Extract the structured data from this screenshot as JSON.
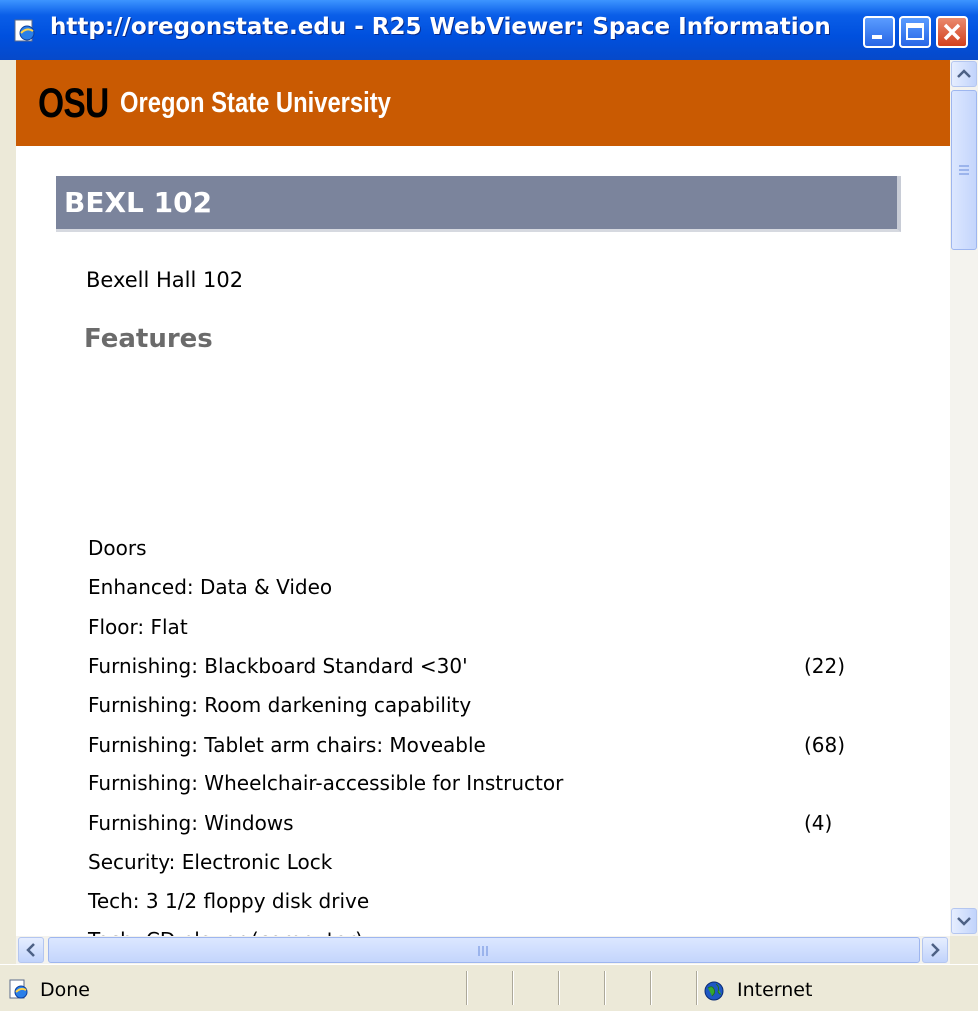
{
  "window": {
    "title": "http://oregonstate.edu - R25 WebViewer: Space Information - Mic..."
  },
  "header": {
    "logo": "OSU",
    "university": "Oregon State University"
  },
  "room": {
    "code": "BEXL 102",
    "name": "Bexell Hall 102"
  },
  "features": {
    "heading": "Features",
    "items": [
      {
        "name": "Doors",
        "qty": ""
      },
      {
        "name": "Enhanced: Data & Video",
        "qty": ""
      },
      {
        "name": "Floor: Flat",
        "qty": ""
      },
      {
        "name": "Furnishing: Blackboard Standard <30'",
        "qty": "(22)"
      },
      {
        "name": "Furnishing: Room darkening capability",
        "qty": ""
      },
      {
        "name": "Furnishing: Tablet arm chairs: Moveable",
        "qty": "(68)"
      },
      {
        "name": "Furnishing: Wheelchair-accessible for Instructor",
        "qty": ""
      },
      {
        "name": "Furnishing: Windows",
        "qty": "(4)"
      },
      {
        "name": "Security: Electronic Lock",
        "qty": ""
      },
      {
        "name": "Tech: 3 1/2 floppy disk drive",
        "qty": ""
      },
      {
        "name": "Tech: CD player (computer)",
        "qty": ""
      }
    ]
  },
  "status": {
    "text": "Done",
    "zone": "Internet"
  },
  "icons": {
    "title": "ie-page-icon",
    "status": "ie-page-icon",
    "zone": "globe-icon"
  },
  "colors": {
    "osu_orange": "#c95a02",
    "room_bar": "#7b849c",
    "titlebar": "#0050de"
  }
}
